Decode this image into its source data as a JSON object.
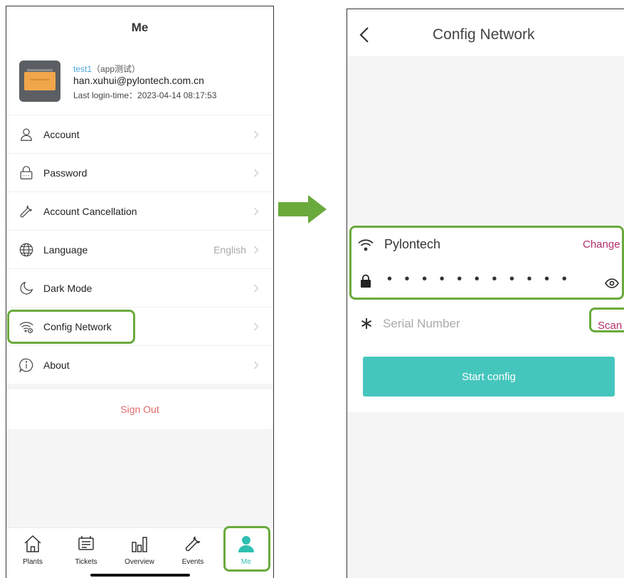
{
  "left": {
    "title": "Me",
    "user": {
      "name": "test1",
      "tag": "（app测试）",
      "email": "han.xuhui@pylontech.com.cn",
      "last_login": "Last login-time：2023-04-14 08:17:53"
    },
    "menu": [
      {
        "label": "Account",
        "icon": "person-icon"
      },
      {
        "label": "Password",
        "icon": "lock-icon"
      },
      {
        "label": "Account Cancellation",
        "icon": "wrench-icon"
      },
      {
        "label": "Language",
        "icon": "globe-icon",
        "value": "English"
      },
      {
        "label": "Dark Mode",
        "icon": "moon-icon"
      },
      {
        "label": "Config Network",
        "icon": "wifi-gear-icon"
      },
      {
        "label": "About",
        "icon": "info-icon"
      }
    ],
    "sign_out": "Sign Out",
    "tabs": [
      {
        "label": "Plants",
        "icon": "home-icon"
      },
      {
        "label": "Tickets",
        "icon": "ticket-icon"
      },
      {
        "label": "Overview",
        "icon": "bar-chart-icon"
      },
      {
        "label": "Events",
        "icon": "wrench-icon"
      },
      {
        "label": "Me",
        "icon": "person-icon",
        "active": true
      }
    ]
  },
  "right": {
    "title": "Config Network",
    "ssid": "Pylontech",
    "change": "Change",
    "password_mask": "• • • • • • • • • • •",
    "serial_placeholder": "Serial Number",
    "scan": "Scan",
    "start": "Start config"
  },
  "colors": {
    "accent": "#45c6bd",
    "link": "#b0306b",
    "sign_out": "#e06a6a",
    "highlight": "#6aaa3c"
  }
}
